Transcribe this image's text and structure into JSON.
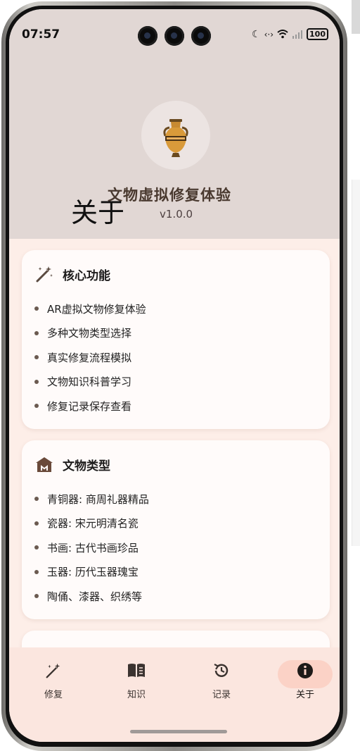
{
  "status_bar": {
    "time": "07:57",
    "battery": "100"
  },
  "header": {
    "page_title": "关于",
    "app_name": "文物虚拟修复体验",
    "version": "v1.0.0"
  },
  "cards": [
    {
      "title": "核心功能",
      "icon": "magic-wand-icon",
      "items": [
        "AR虚拟文物修复体验",
        "多种文物类型选择",
        "真实修复流程模拟",
        "文物知识科普学习",
        "修复记录保存查看"
      ]
    },
    {
      "title": "文物类型",
      "icon": "museum-icon",
      "items": [
        "青铜器: 商周礼器精品",
        "瓷器: 宋元明清名瓷",
        "书画: 古代书画珍品",
        "玉器: 历代玉器瑰宝",
        "陶俑、漆器、织绣等"
      ]
    }
  ],
  "nav": {
    "items": [
      {
        "label": "修复",
        "icon": "magic-wand-icon"
      },
      {
        "label": "知识",
        "icon": "book-icon"
      },
      {
        "label": "记录",
        "icon": "history-icon"
      },
      {
        "label": "关于",
        "icon": "info-icon"
      }
    ],
    "active": "关于"
  },
  "colors": {
    "header_bg": "#e1d7d4",
    "page_bg": "#fdeee8",
    "accent_pill": "#fbd2c6",
    "brand_brown": "#4a3a30"
  }
}
